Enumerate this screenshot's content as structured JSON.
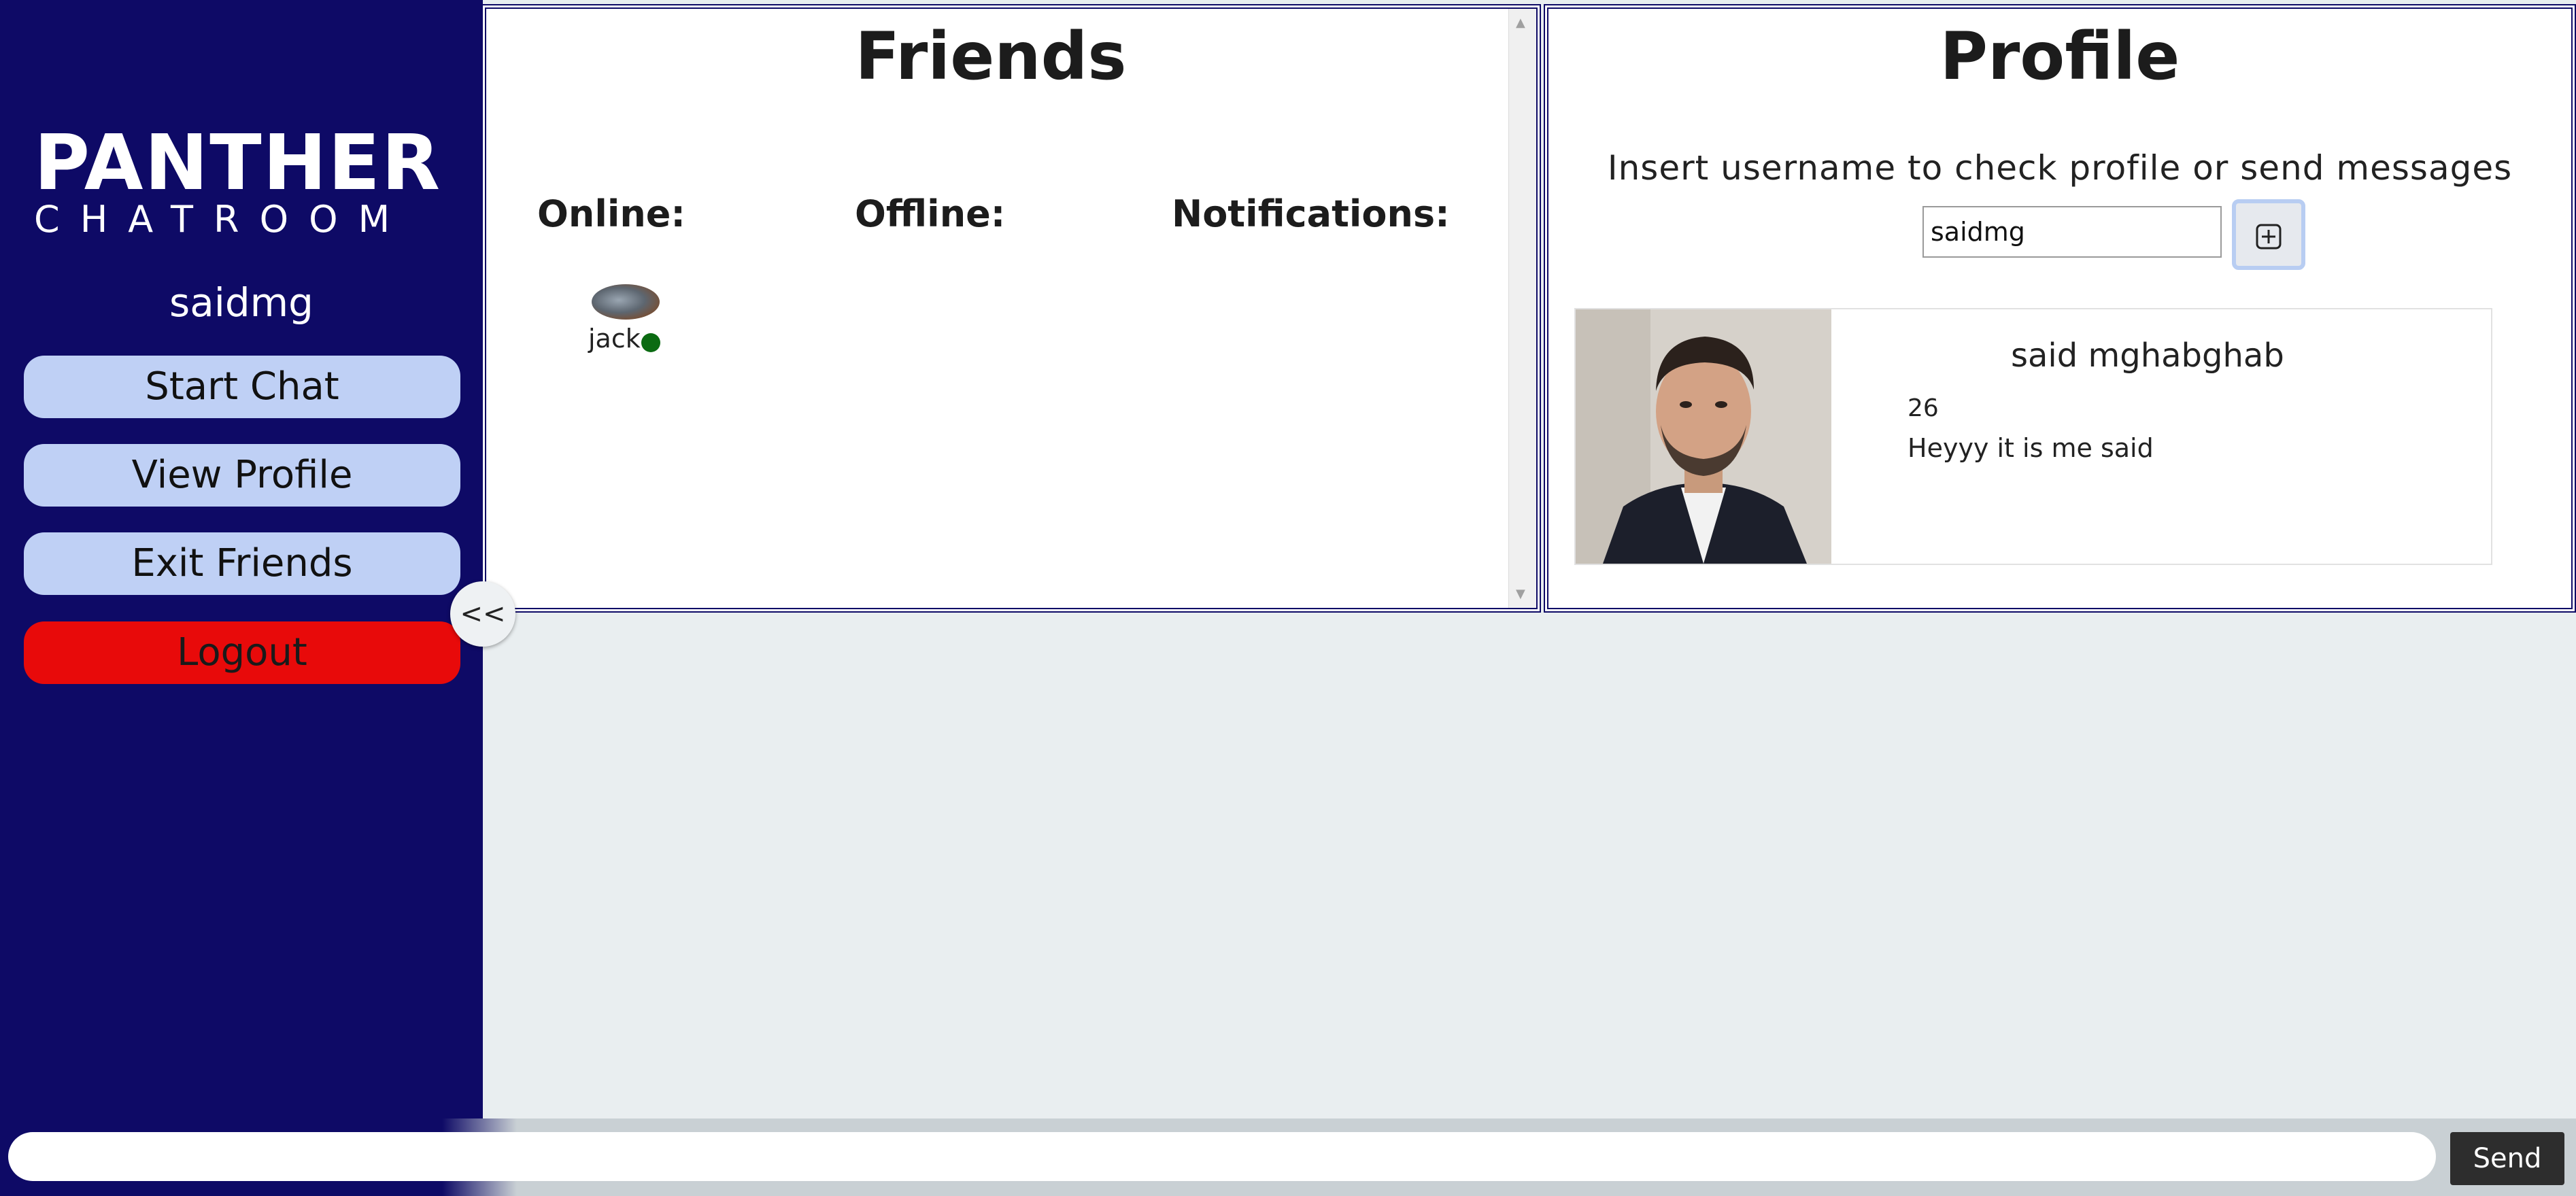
{
  "sidebar": {
    "logo_main": "PANTHER",
    "logo_sub": "CHATROOM",
    "username": "saidmg",
    "buttons": {
      "start_chat": "Start Chat",
      "view_profile": "View Profile",
      "exit_friends": "Exit Friends",
      "logout": "Logout"
    },
    "collapse_label": "<<"
  },
  "friends": {
    "title": "Friends",
    "columns": {
      "online": "Online:",
      "offline": "Offline:",
      "notifications": "Notifications:"
    },
    "online_list": [
      {
        "name": "jack",
        "status": "online"
      }
    ]
  },
  "profile": {
    "title": "Profile",
    "instruction": "Insert username to check profile or send messages",
    "search_value": "saidmg",
    "add_icon": "plus-square-icon",
    "card": {
      "full_name": "said mghabghab",
      "age": "26",
      "bio": "Heyyy it is me said"
    }
  },
  "bottom": {
    "message_value": "",
    "send_label": "Send"
  },
  "colors": {
    "sidebar_bg": "#0e0a66",
    "button_bg": "#bfd0f5",
    "logout_bg": "#e80a0a",
    "online_dot": "#0b6b12",
    "page_bg": "#e9eef0"
  }
}
